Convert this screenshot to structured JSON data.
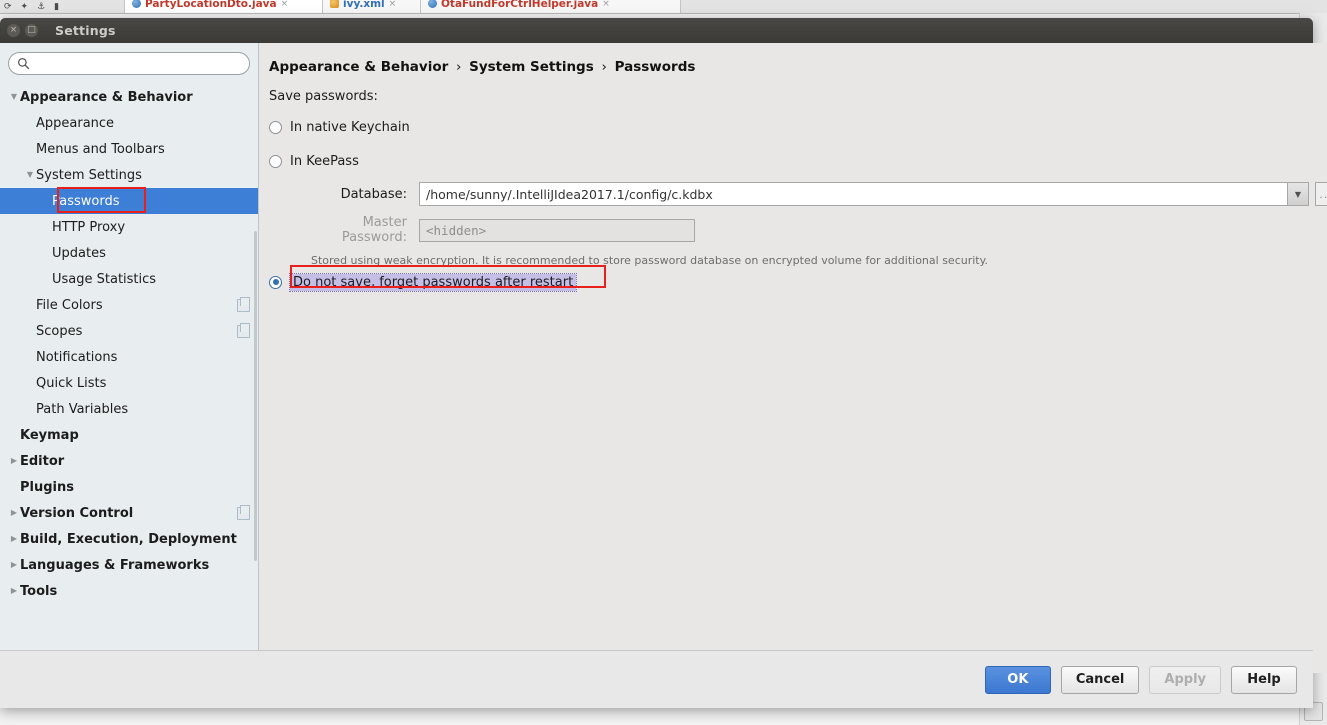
{
  "ide": {
    "tabs": [
      {
        "name": "PartyLocationDto.java",
        "icon": "java-class-icon",
        "active": true
      },
      {
        "name": "ivy.xml",
        "icon": "xml-file-icon",
        "active": false
      },
      {
        "name": "OtaFundForCtrlHelper.java",
        "icon": "java-class-icon",
        "active": false
      }
    ],
    "close_glyph": "×"
  },
  "dialog": {
    "title": "Settings",
    "titlebar": {
      "close_glyph": "×",
      "maximize_glyph": "□"
    }
  },
  "search": {
    "value": "",
    "placeholder": ""
  },
  "sidebar": {
    "items": [
      {
        "label": "Appearance & Behavior",
        "indent": 0,
        "arrow": "expanded",
        "bold": true,
        "selected": false,
        "copy_icon": false
      },
      {
        "label": "Appearance",
        "indent": 1,
        "arrow": "none",
        "bold": false,
        "selected": false,
        "copy_icon": false
      },
      {
        "label": "Menus and Toolbars",
        "indent": 1,
        "arrow": "none",
        "bold": false,
        "selected": false,
        "copy_icon": false
      },
      {
        "label": "System Settings",
        "indent": 1,
        "arrow": "expanded",
        "bold": false,
        "selected": false,
        "copy_icon": false
      },
      {
        "label": "Passwords",
        "indent": 2,
        "arrow": "none",
        "bold": false,
        "selected": true,
        "copy_icon": false
      },
      {
        "label": "HTTP Proxy",
        "indent": 2,
        "arrow": "none",
        "bold": false,
        "selected": false,
        "copy_icon": false
      },
      {
        "label": "Updates",
        "indent": 2,
        "arrow": "none",
        "bold": false,
        "selected": false,
        "copy_icon": false
      },
      {
        "label": "Usage Statistics",
        "indent": 2,
        "arrow": "none",
        "bold": false,
        "selected": false,
        "copy_icon": false
      },
      {
        "label": "File Colors",
        "indent": 1,
        "arrow": "none",
        "bold": false,
        "selected": false,
        "copy_icon": true
      },
      {
        "label": "Scopes",
        "indent": 1,
        "arrow": "none",
        "bold": false,
        "selected": false,
        "copy_icon": true
      },
      {
        "label": "Notifications",
        "indent": 1,
        "arrow": "none",
        "bold": false,
        "selected": false,
        "copy_icon": false
      },
      {
        "label": "Quick Lists",
        "indent": 1,
        "arrow": "none",
        "bold": false,
        "selected": false,
        "copy_icon": false
      },
      {
        "label": "Path Variables",
        "indent": 1,
        "arrow": "none",
        "bold": false,
        "selected": false,
        "copy_icon": false
      },
      {
        "label": "Keymap",
        "indent": 0,
        "arrow": "none",
        "bold": true,
        "selected": false,
        "copy_icon": false
      },
      {
        "label": "Editor",
        "indent": 0,
        "arrow": "collapsed",
        "bold": true,
        "selected": false,
        "copy_icon": false
      },
      {
        "label": "Plugins",
        "indent": 0,
        "arrow": "none",
        "bold": true,
        "selected": false,
        "copy_icon": false
      },
      {
        "label": "Version Control",
        "indent": 0,
        "arrow": "collapsed",
        "bold": true,
        "selected": false,
        "copy_icon": true
      },
      {
        "label": "Build, Execution, Deployment",
        "indent": 0,
        "arrow": "collapsed",
        "bold": true,
        "selected": false,
        "copy_icon": false
      },
      {
        "label": "Languages & Frameworks",
        "indent": 0,
        "arrow": "collapsed",
        "bold": true,
        "selected": false,
        "copy_icon": false
      },
      {
        "label": "Tools",
        "indent": 0,
        "arrow": "collapsed",
        "bold": true,
        "selected": false,
        "copy_icon": false
      }
    ]
  },
  "breadcrumb": {
    "parts": [
      "Appearance & Behavior",
      "System Settings",
      "Passwords"
    ],
    "separator": "›"
  },
  "main": {
    "section_label": "Save passwords:",
    "options": [
      {
        "label": "In native Keychain",
        "selected": false,
        "highlighted": false
      },
      {
        "label": "In KeePass",
        "selected": false,
        "highlighted": false
      },
      {
        "label": "Do not save, forget passwords after restart",
        "selected": true,
        "highlighted": true
      }
    ],
    "database": {
      "label": "Database:",
      "value": "/home/sunny/.IntelliJIdea2017.1/config/c.kdbx",
      "placeholder": "",
      "dropdown_glyph": "▼",
      "browse_label": "..."
    },
    "master_password": {
      "label": "Master Password:",
      "placeholder": "<hidden>",
      "disabled": true
    },
    "hint": "Stored using weak encryption. It is recommended to store password database on encrypted volume for additional security."
  },
  "footer": {
    "ok": "OK",
    "cancel": "Cancel",
    "apply": "Apply",
    "help": "Help"
  },
  "colors": {
    "selection_blue": "#3d7ed6",
    "primary_button": "#3b77d0",
    "annotation_red": "#e8201b",
    "highlight_lavender": "#c5bfe8"
  }
}
